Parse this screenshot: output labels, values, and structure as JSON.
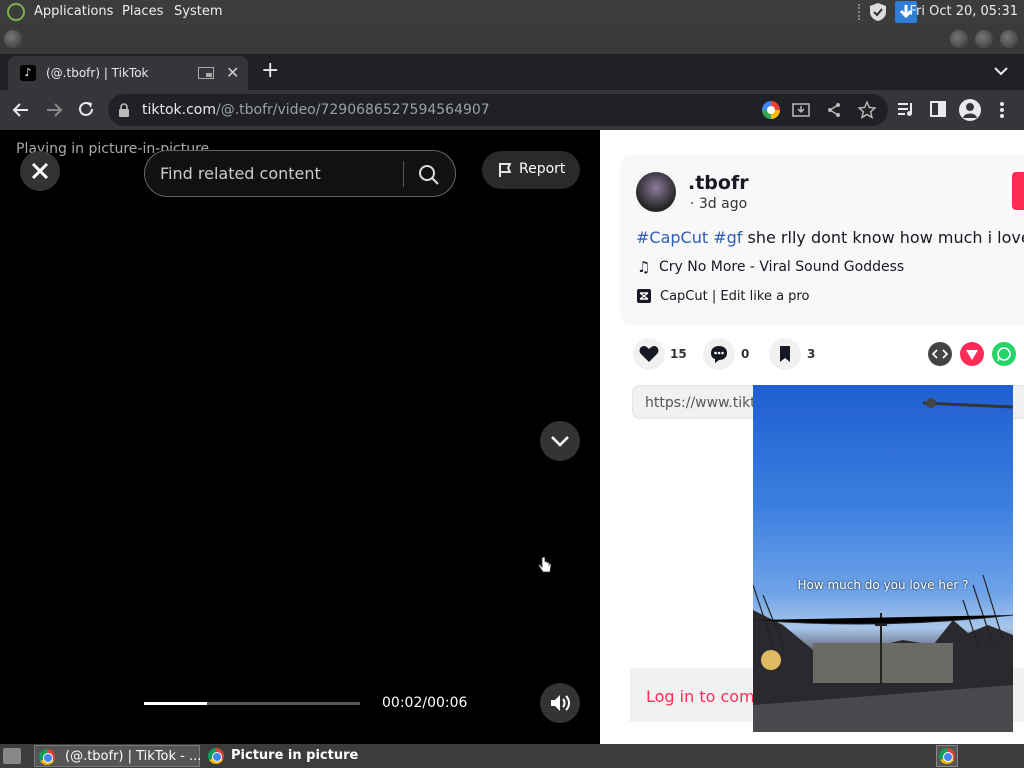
{
  "os": {
    "menu": [
      "Applications",
      "Places",
      "System"
    ],
    "clock": "Fri Oct 20, 05:31"
  },
  "browser": {
    "tab_title": "(@.tbofr) | TikTok",
    "url_host": "tiktok.com",
    "url_path": "/@.tbofr/video/7290686527594564907"
  },
  "player": {
    "pip_notice": "Playing in picture-in-picture",
    "search_placeholder": "Find related content",
    "report_label": "Report",
    "time": "00:02/00:06",
    "progress": 0.29
  },
  "post": {
    "username": ".tbofr",
    "time_ago": "· 3d ago",
    "hashtags": [
      "#CapCut",
      "#gf"
    ],
    "caption": "she rlly dont know how much i lover her",
    "sound": "Cry No More - Viral Sound Goddess",
    "capcut": "CapCut | Edit like a pro",
    "likes": "15",
    "comments": "0",
    "saves": "3",
    "link_prefix": "https://www.tikto",
    "login_label": "Log in to comm"
  },
  "pip": {
    "overlay_text": "How much do you love her ?"
  },
  "taskbar": {
    "items": [
      "(@.tbofr) | TikTok - ...",
      "Picture in picture"
    ]
  },
  "colors": {
    "tiktok_red": "#fe2c55",
    "hashtag_blue": "#2b5db9"
  }
}
